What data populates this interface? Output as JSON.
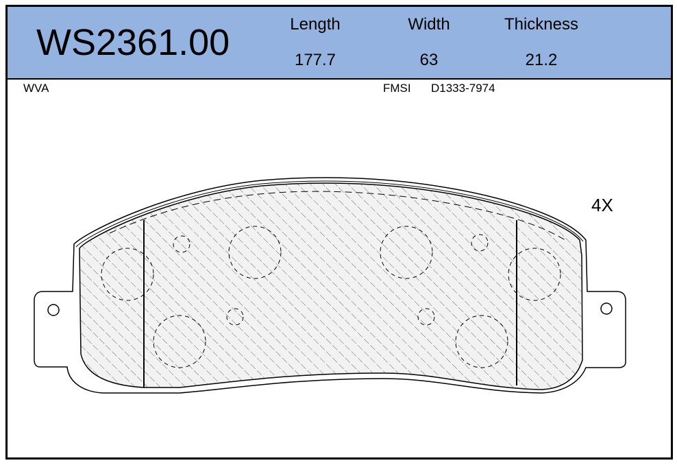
{
  "header": {
    "part_number": "WS2361.00",
    "columns": [
      {
        "label": "Length",
        "value": "177.7"
      },
      {
        "label": "Width",
        "value": "63"
      },
      {
        "label": "Thickness",
        "value": "21.2"
      }
    ]
  },
  "meta": {
    "brand": "WVA",
    "fmsi_label": "FMSI",
    "fmsi_value": "D1333-7974"
  },
  "drawing": {
    "quantity": "4X",
    "header_color": "#95b3e0"
  }
}
